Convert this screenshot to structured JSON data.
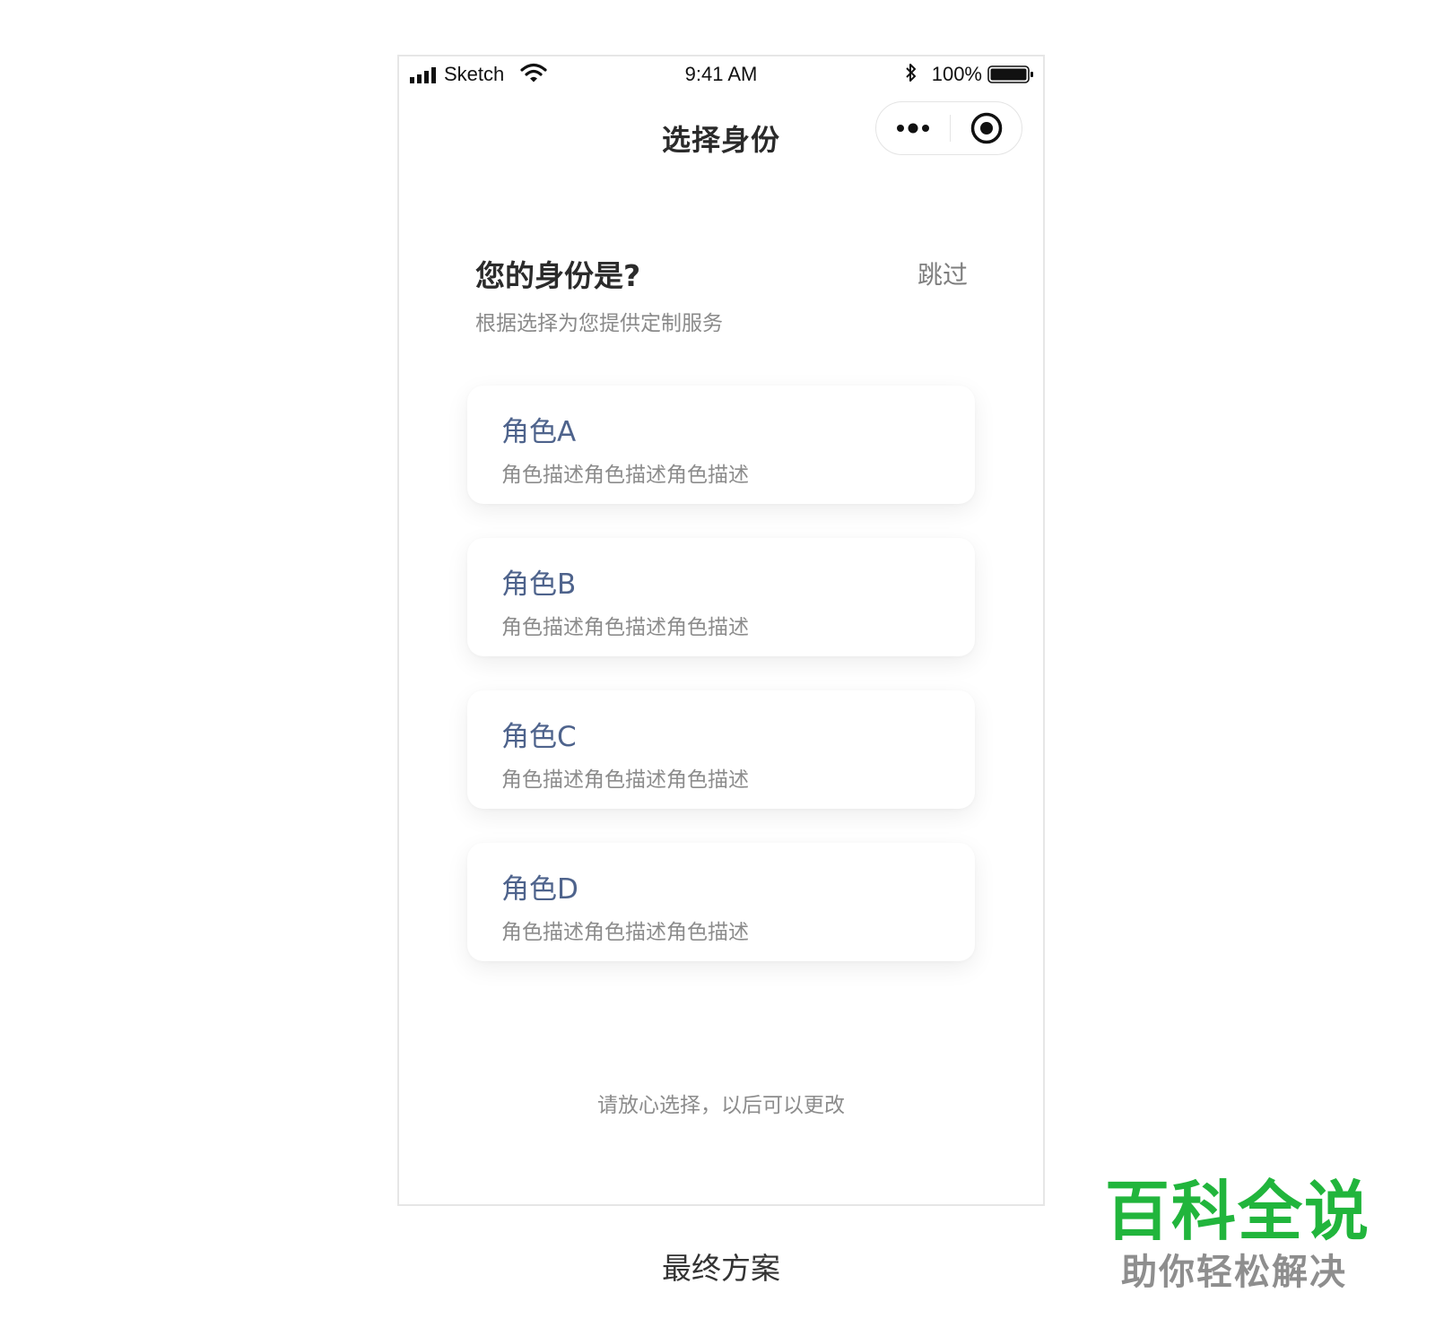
{
  "status_bar": {
    "carrier": "Sketch",
    "time": "9:41 AM",
    "battery_percent": "100%",
    "battery_level": 1.0,
    "icons": [
      "signal-icon",
      "wifi-icon",
      "bluetooth-icon",
      "battery-icon"
    ]
  },
  "nav": {
    "title": "选择身份",
    "more_icon": "more-dots-icon",
    "close_icon": "target-circle-icon"
  },
  "header": {
    "question": "您的身份是?",
    "skip_label": "跳过",
    "subtitle": "根据选择为您提供定制服务"
  },
  "roles": [
    {
      "title": "角色A",
      "description": "角色描述角色描述角色描述"
    },
    {
      "title": "角色B",
      "description": "角色描述角色描述角色描述"
    },
    {
      "title": "角色C",
      "description": "角色描述角色描述角色描述"
    },
    {
      "title": "角色D",
      "description": "角色描述角色描述角色描述"
    }
  ],
  "footer_note": "请放心选择，以后可以更改",
  "caption": "最终方案",
  "watermark": {
    "main": "百科全说",
    "sub": "助你轻松解决"
  },
  "colors": {
    "role_title": "#4e638c",
    "watermark_green": "#21b53c",
    "muted_text": "#8c8c8c"
  }
}
